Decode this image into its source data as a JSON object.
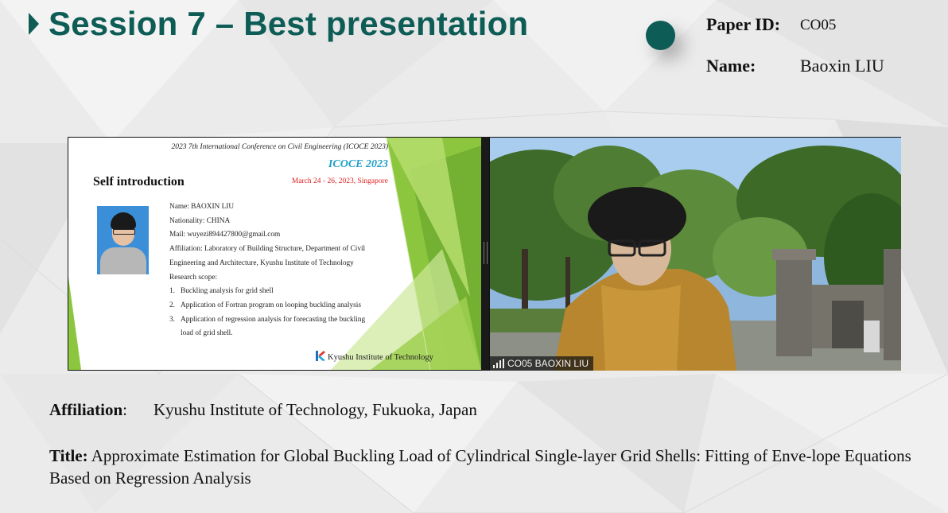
{
  "session": {
    "title": "Session 7 – Best presentation"
  },
  "paper": {
    "id_label": "Paper ID:",
    "id_value": "CO05",
    "name_label": "Name:",
    "name_value": "Baoxin LIU"
  },
  "slide": {
    "conference": "2023 7th International Conference on Civil Engineering (ICOCE 2023)",
    "acronym": "ICOCE 2023",
    "dates": "March 24 - 26, 2023, Singapore",
    "heading": "Self introduction",
    "info": {
      "name": "Name: BAOXIN LIU",
      "nationality": "Nationality: CHINA",
      "mail": "Mail: wuyezi894427800@gmail.com",
      "affiliation_line1": "Affiliation: Laboratory of Building Structure, Department of Civil",
      "affiliation_line2": "Engineering and Architecture, Kyushu Institute of  Technology",
      "scope_label": "Research scope:",
      "scope_items": [
        {
          "num": "1.",
          "text": "Buckling analysis for grid shell"
        },
        {
          "num": "2.",
          "text": "Application of Fortran program on looping buckling analysis"
        },
        {
          "num": "3.",
          "text": "Application of regression analysis for forecasting the buckling"
        }
      ],
      "scope_item3_cont": "load of grid shell."
    },
    "footer": "Kyushu Institute of Technology",
    "colors": {
      "acronym": "#21a0c8",
      "dates": "#e02020",
      "accent_green": "#8cc63f"
    }
  },
  "video": {
    "participant": "CO05 BAOXIN LIU",
    "signal_icon": "signal-bars-icon"
  },
  "details": {
    "affiliation_label": "Affiliation",
    "affiliation_sep": ":",
    "affiliation_value": "Kyushu Institute of Technology, Fukuoka, Japan",
    "title_label": "Title:",
    "title_value": "Approximate Estimation for Global Buckling Load of Cylindrical Single-layer Grid Shells: Fitting of Enve-lope Equations Based on Regression Analysis"
  },
  "theme": {
    "primary": "#0d5c56",
    "background": "#ececec"
  }
}
